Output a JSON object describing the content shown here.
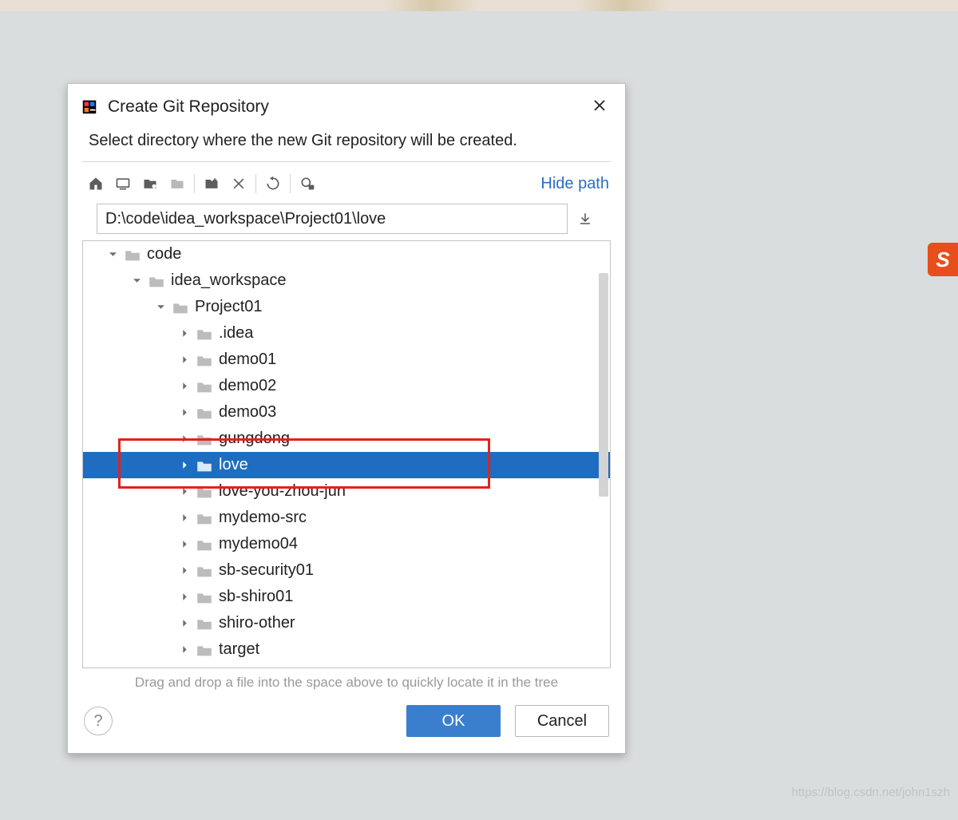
{
  "dialog": {
    "title": "Create Git Repository",
    "instruction": "Select directory where the new Git repository will be created.",
    "hide_path_label": "Hide path",
    "path_value": "D:\\code\\idea_workspace\\Project01\\love",
    "hint": "Drag and drop a file into the space above to quickly locate it in the tree",
    "ok_label": "OK",
    "cancel_label": "Cancel",
    "help_label": "?"
  },
  "tree": [
    {
      "label": "code",
      "depth": 0,
      "expanded": true,
      "selected": false
    },
    {
      "label": "idea_workspace",
      "depth": 1,
      "expanded": true,
      "selected": false
    },
    {
      "label": "Project01",
      "depth": 2,
      "expanded": true,
      "selected": false
    },
    {
      "label": ".idea",
      "depth": 3,
      "expanded": false,
      "selected": false
    },
    {
      "label": "demo01",
      "depth": 3,
      "expanded": false,
      "selected": false
    },
    {
      "label": "demo02",
      "depth": 3,
      "expanded": false,
      "selected": false
    },
    {
      "label": "demo03",
      "depth": 3,
      "expanded": false,
      "selected": false
    },
    {
      "label": "gungdong",
      "depth": 3,
      "expanded": false,
      "selected": false
    },
    {
      "label": "love",
      "depth": 3,
      "expanded": false,
      "selected": true
    },
    {
      "label": "love-you-zhou-jun",
      "depth": 3,
      "expanded": false,
      "selected": false
    },
    {
      "label": "mydemo-src",
      "depth": 3,
      "expanded": false,
      "selected": false
    },
    {
      "label": "mydemo04",
      "depth": 3,
      "expanded": false,
      "selected": false
    },
    {
      "label": "sb-security01",
      "depth": 3,
      "expanded": false,
      "selected": false
    },
    {
      "label": "sb-shiro01",
      "depth": 3,
      "expanded": false,
      "selected": false
    },
    {
      "label": "shiro-other",
      "depth": 3,
      "expanded": false,
      "selected": false
    },
    {
      "label": "target",
      "depth": 3,
      "expanded": false,
      "selected": false
    }
  ],
  "side_badge": "S",
  "watermark": "https://blog.csdn.net/john1szh"
}
